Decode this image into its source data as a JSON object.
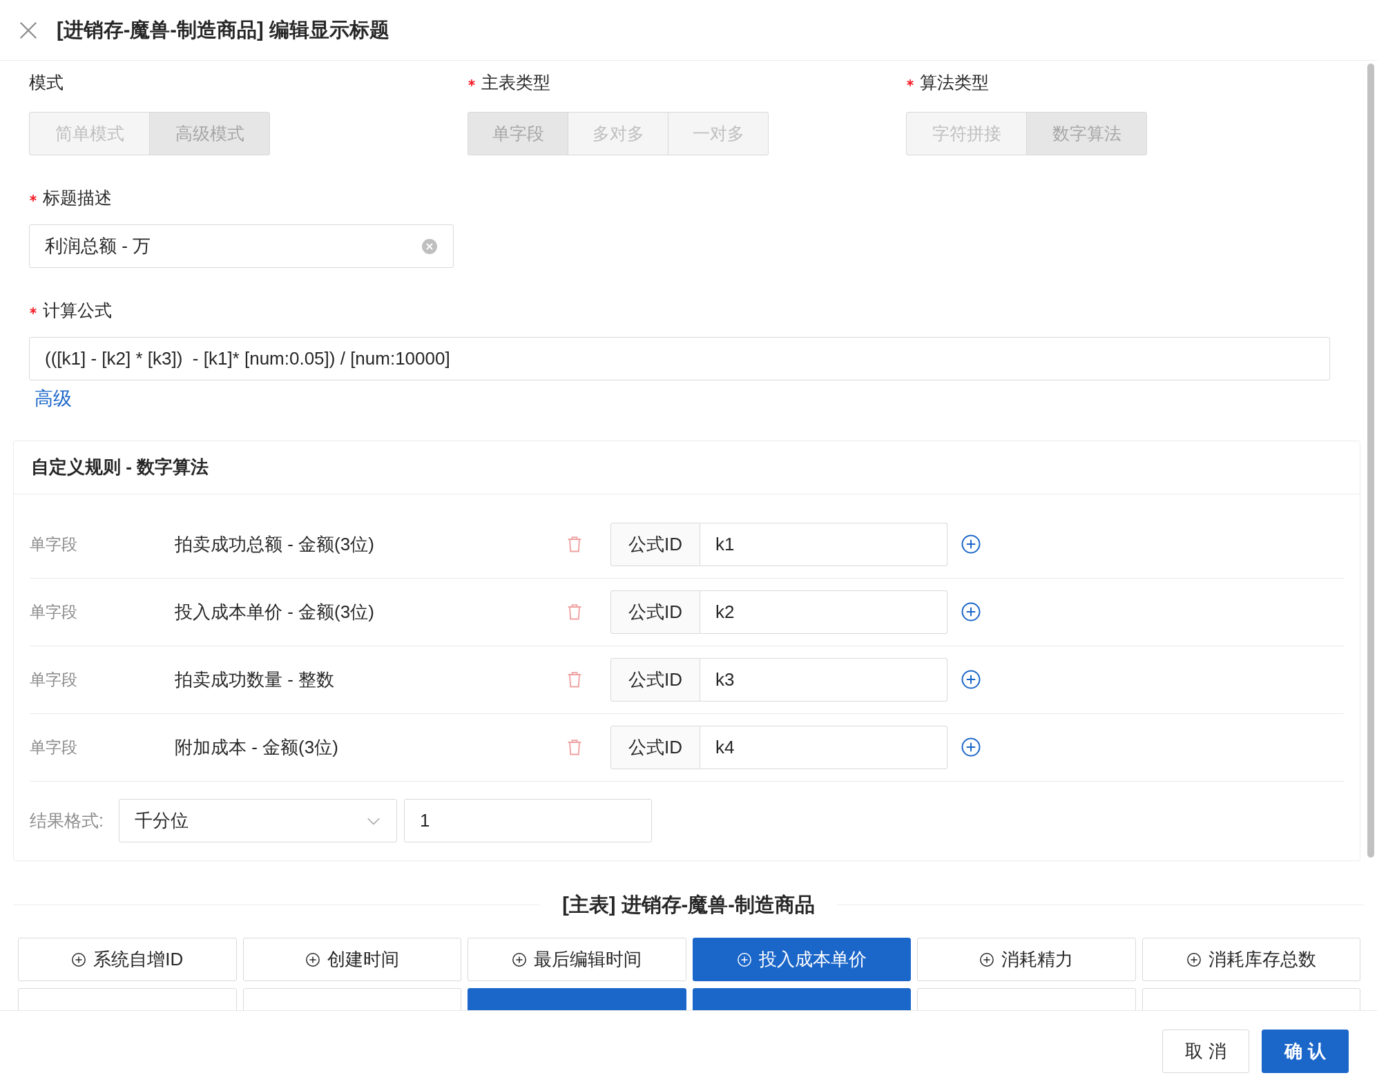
{
  "dialog": {
    "title": "[进销存-魔兽-制造商品] 编辑显示标题"
  },
  "segments": [
    {
      "label": "模式",
      "required": false,
      "options": [
        {
          "label": "简单模式",
          "selected": false
        },
        {
          "label": "高级模式",
          "selected": true
        }
      ]
    },
    {
      "label": "主表类型",
      "required": true,
      "options": [
        {
          "label": "单字段",
          "selected": true
        },
        {
          "label": "多对多",
          "selected": false
        },
        {
          "label": "一对多",
          "selected": false
        }
      ]
    },
    {
      "label": "算法类型",
      "required": true,
      "options": [
        {
          "label": "字符拼接",
          "selected": false
        },
        {
          "label": "数字算法",
          "selected": true
        }
      ]
    }
  ],
  "title_field": {
    "label": "标题描述",
    "required": true,
    "value": "利润总额 - 万"
  },
  "formula_field": {
    "label": "计算公式",
    "required": true,
    "value": "(([k1] - [k2] * [k3])  - [k1]* [num:0.05]) / [num:10000]",
    "link": "高级"
  },
  "rules": {
    "title": "自定义规则 - 数字算法",
    "rows": [
      {
        "type": "单字段",
        "field": "拍卖成功总额 - 金额(3位)",
        "addon": "公式ID",
        "value": "k1"
      },
      {
        "type": "单字段",
        "field": "投入成本单价 - 金额(3位)",
        "addon": "公式ID",
        "value": "k2"
      },
      {
        "type": "单字段",
        "field": "拍卖成功数量 - 整数",
        "addon": "公式ID",
        "value": "k3"
      },
      {
        "type": "单字段",
        "field": "附加成本 - 金额(3位)",
        "addon": "公式ID",
        "value": "k4"
      }
    ],
    "result_format": {
      "label": "结果格式:",
      "select": "千分位",
      "value": "1"
    }
  },
  "main_table": {
    "title": "[主表] 进销存-魔兽-制造商品",
    "fields": [
      {
        "label": "系统自增ID",
        "selected": false
      },
      {
        "label": "创建时间",
        "selected": false
      },
      {
        "label": "最后编辑时间",
        "selected": false
      },
      {
        "label": "投入成本单价",
        "selected": true
      },
      {
        "label": "消耗精力",
        "selected": false
      },
      {
        "label": "消耗库存总数",
        "selected": false
      },
      {
        "selected": false
      },
      {
        "selected": false
      },
      {
        "selected": true
      },
      {
        "selected": true
      },
      {
        "selected": false
      },
      {
        "selected": false
      }
    ]
  },
  "footer": {
    "buttons": [
      {
        "label": "取 消",
        "kind": "default"
      },
      {
        "label": "确 认",
        "kind": "primary"
      }
    ]
  }
}
